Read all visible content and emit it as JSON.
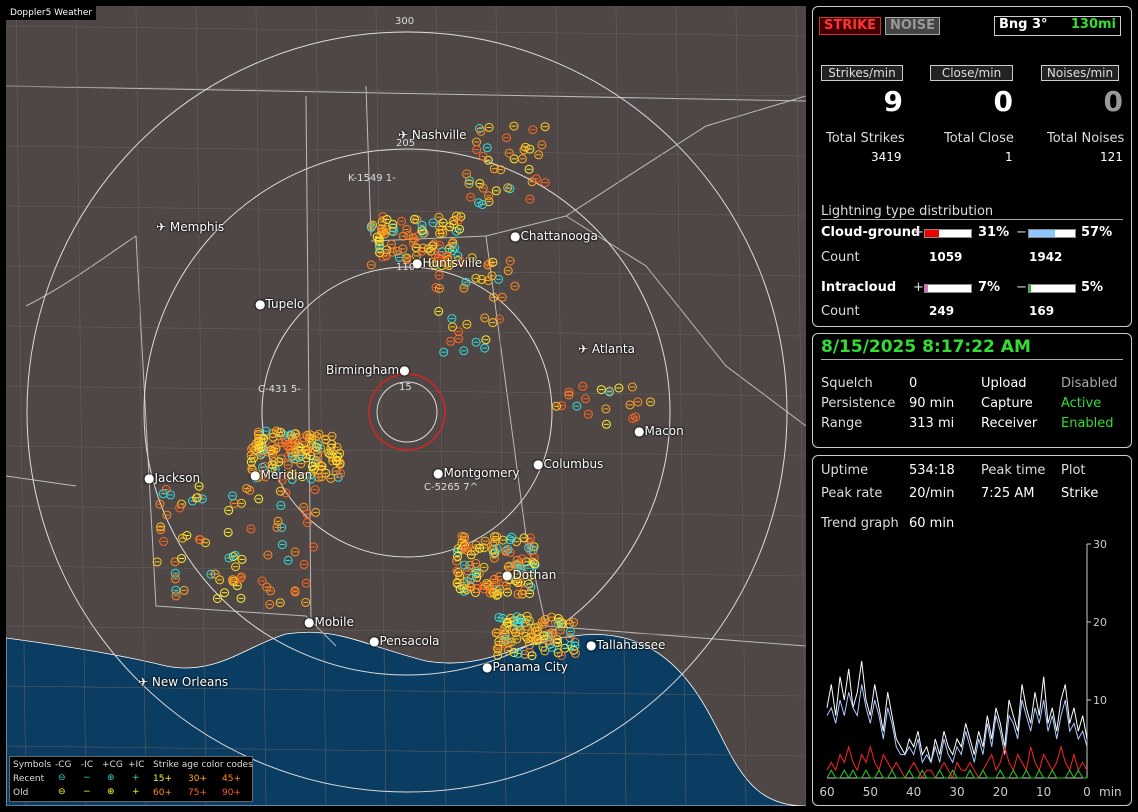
{
  "app": {
    "brand": "Doppler5 Weather"
  },
  "map": {
    "cities": [
      {
        "name": "Nashville",
        "airport": true
      },
      {
        "name": "Memphis",
        "airport": true
      },
      {
        "name": "Chattanooga",
        "airport": false
      },
      {
        "name": "Huntsville",
        "airport": false
      },
      {
        "name": "Tupelo",
        "airport": false
      },
      {
        "name": "Birmingham",
        "airport": false
      },
      {
        "name": "Atlanta",
        "airport": true
      },
      {
        "name": "Macon",
        "airport": false
      },
      {
        "name": "Jackson",
        "airport": false
      },
      {
        "name": "Meridian",
        "airport": false
      },
      {
        "name": "Montgomery",
        "airport": false
      },
      {
        "name": "Columbus",
        "airport": false
      },
      {
        "name": "Dothan",
        "airport": false
      },
      {
        "name": "Mobile",
        "airport": false
      },
      {
        "name": "Pensacola",
        "airport": false
      },
      {
        "name": "Tallahassee",
        "airport": false
      },
      {
        "name": "Panama City",
        "airport": false
      },
      {
        "name": "New Orleans",
        "airport": true
      }
    ],
    "ring_labels": [
      "300",
      "205",
      "110",
      "15"
    ],
    "cluster_labels": [
      "K-1549 1-",
      "C-431 5-",
      "C-5265 7^"
    ]
  },
  "legend": {
    "symbols_label": "Symbols",
    "cols": [
      "-CG",
      "-IC",
      "+CG",
      "+IC"
    ],
    "recent_label": "Recent",
    "old_label": "Old",
    "age_title": "Strike age color codes",
    "recent_ages": [
      "15+",
      "30+",
      "45+"
    ],
    "old_ages": [
      "60+",
      "75+",
      "90+"
    ]
  },
  "status": {
    "strike_button": "STRIKE",
    "noise_button": "NOISE",
    "bearing": "Bng 3°",
    "range": "130mi",
    "headers": [
      "Strikes/min",
      "Close/min",
      "Noises/min"
    ],
    "rates": [
      "9",
      "0",
      "0"
    ],
    "total_labels": [
      "Total Strikes",
      "Total Close",
      "Total Noises"
    ],
    "totals": [
      "3419",
      "1",
      "121"
    ]
  },
  "distribution": {
    "title": "Lightning type distribution",
    "cg_label": "Cloud-ground",
    "ic_label": "Intracloud",
    "count_label": "Count",
    "cg_pos_pct": "31%",
    "cg_neg_pct": "57%",
    "cg_pos_count": "1059",
    "cg_neg_count": "1942",
    "ic_pos_pct": "7%",
    "ic_neg_pct": "5%",
    "ic_pos_count": "249",
    "ic_neg_count": "169",
    "cg_pos_frac": 0.31,
    "cg_neg_frac": 0.57,
    "ic_pos_frac": 0.07,
    "ic_neg_frac": 0.05
  },
  "settings": {
    "datetime": "8/15/2025 8:17:22 AM",
    "labels": [
      "Squelch",
      "Persistence",
      "Range"
    ],
    "values": [
      "0",
      "90 min",
      "313 mi"
    ],
    "labels2": [
      "Upload",
      "Capture",
      "Receiver"
    ],
    "values2": [
      "Disabled",
      "Active",
      "Enabled"
    ]
  },
  "stats": {
    "uptime_label": "Uptime",
    "uptime": "534:18",
    "peak_time_label": "Peak time",
    "peak_time": "7:25 AM",
    "plot_label": "Plot",
    "plot": "Strike",
    "peak_rate_label": "Peak rate",
    "peak_rate": "20/min",
    "trend_label": "Trend graph",
    "trend": "60 min"
  },
  "chart_data": {
    "type": "line",
    "xlabel": "min",
    "x_ticks": [
      "60",
      "50",
      "40",
      "30",
      "20",
      "10",
      "0"
    ],
    "y_ticks": [
      "30",
      "20",
      "10"
    ],
    "xlim": [
      60,
      0
    ],
    "ylim": [
      0,
      30
    ],
    "series": [
      {
        "color": "#ffffff",
        "values": [
          9,
          12,
          8,
          13,
          10,
          14,
          9,
          11,
          15,
          10,
          8,
          12,
          9,
          6,
          11,
          8,
          5,
          4,
          3,
          5,
          4,
          6,
          3,
          4,
          2,
          5,
          3,
          6,
          4,
          3,
          5,
          4,
          7,
          5,
          3,
          6,
          4,
          8,
          5,
          9,
          7,
          4,
          10,
          8,
          6,
          12,
          9,
          7,
          11,
          8,
          13,
          7,
          9,
          6,
          10,
          12,
          7,
          9,
          6,
          8,
          5
        ]
      },
      {
        "color": "#aaccff",
        "values": [
          8,
          9,
          7,
          10,
          8,
          11,
          9,
          8,
          12,
          9,
          7,
          10,
          8,
          5,
          9,
          7,
          4,
          3,
          3,
          4,
          3,
          5,
          2,
          3,
          2,
          4,
          2,
          5,
          3,
          2,
          4,
          3,
          6,
          4,
          2,
          5,
          3,
          7,
          4,
          8,
          6,
          3,
          8,
          7,
          5,
          10,
          8,
          6,
          9,
          7,
          10,
          6,
          8,
          5,
          8,
          10,
          6,
          7,
          5,
          6,
          4
        ]
      },
      {
        "color": "#ff2222",
        "values": [
          1,
          2,
          1,
          3,
          2,
          4,
          2,
          1,
          3,
          2,
          4,
          2,
          1,
          3,
          2,
          1,
          2,
          1,
          0,
          1,
          2,
          1,
          0,
          1,
          1,
          0,
          1,
          2,
          1,
          0,
          2,
          1,
          1,
          2,
          1,
          0,
          1,
          2,
          3,
          1,
          2,
          4,
          2,
          1,
          3,
          2,
          1,
          4,
          2,
          1,
          3,
          2,
          1,
          2,
          4,
          2,
          1,
          3,
          1,
          2,
          1
        ]
      },
      {
        "color": "#22cc22",
        "values": [
          0,
          1,
          0,
          0,
          1,
          0,
          1,
          0,
          0,
          1,
          0,
          0,
          1,
          0,
          0,
          1,
          0,
          0,
          0,
          1,
          0,
          0,
          1,
          0,
          0,
          0,
          1,
          0,
          0,
          1,
          0,
          0,
          0,
          1,
          0,
          0,
          1,
          0,
          0,
          0,
          1,
          0,
          0,
          1,
          0,
          0,
          1,
          0,
          0,
          1,
          0,
          0,
          1,
          0,
          0,
          0,
          1,
          0,
          1,
          0,
          0
        ]
      }
    ]
  }
}
